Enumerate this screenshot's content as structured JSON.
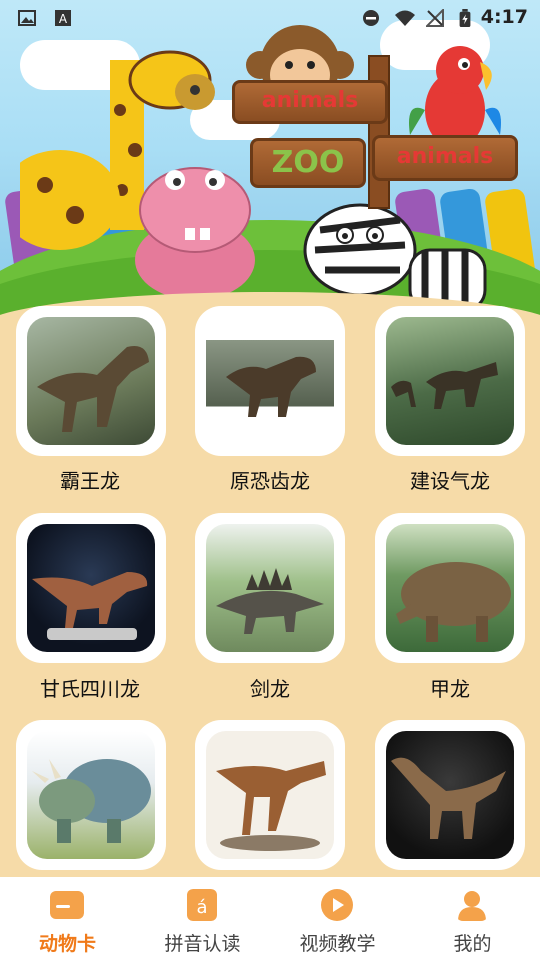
{
  "status_bar": {
    "time": "4:17",
    "left_icons": [
      "image-icon",
      "text-a-icon"
    ],
    "right_icons": [
      "dnd-icon",
      "wifi-icon",
      "no-signal-icon",
      "battery-icon"
    ]
  },
  "banner": {
    "sign_top": "animals",
    "sign_middle": "ZOO",
    "sign_right": "animals"
  },
  "cards": [
    {
      "label": "霸王龙",
      "theme": "#6b7a5a"
    },
    {
      "label": "原恐齿龙",
      "theme": "#5d6a5f"
    },
    {
      "label": "建设气龙",
      "theme": "#4c6b47"
    },
    {
      "label": "甘氏四川龙",
      "theme": "#1a2230"
    },
    {
      "label": "剑龙",
      "theme": "#6f8a5e"
    },
    {
      "label": "甲龙",
      "theme": "#3d6a3a"
    },
    {
      "label": "",
      "theme": "#6a8d9a"
    },
    {
      "label": "",
      "theme": "#e9e2d6"
    },
    {
      "label": "",
      "theme": "#1b1b1b"
    }
  ],
  "nav": {
    "items": [
      {
        "label": "动物卡",
        "icon": "card-icon",
        "active": true
      },
      {
        "label": "拼音认读",
        "icon": "pinyin-icon",
        "active": false
      },
      {
        "label": "视频教学",
        "icon": "play-icon",
        "active": false
      },
      {
        "label": "我的",
        "icon": "user-icon",
        "active": false
      }
    ],
    "active_color": "#f07a1a",
    "icon_color": "#f4a24a"
  }
}
